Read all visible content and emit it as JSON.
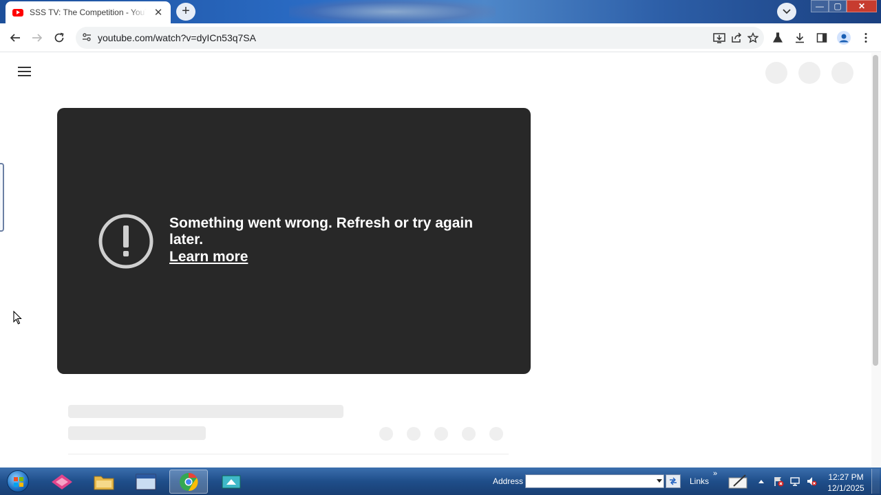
{
  "browser": {
    "tab": {
      "title": "SSS TV: The Competition - YouTube",
      "favicon": "youtube-icon",
      "close": "✕"
    },
    "new_tab": "+",
    "address_bar": {
      "url": "youtube.com/watch?v=dyICn53q7SA"
    },
    "window_controls": {
      "minimize": "—",
      "maximize": "▢",
      "close": "✕"
    }
  },
  "page": {
    "error": {
      "message": "Something went wrong. Refresh or try again later.",
      "link": "Learn more"
    }
  },
  "taskbar": {
    "address_label": "Address",
    "links_label": "Links",
    "links_chevron": "»",
    "clock": {
      "time": "12:27 PM",
      "date": "12/1/2025"
    }
  },
  "colors": {
    "player_background": "#282828",
    "youtube_red": "#ff0000",
    "skeleton": "#ececec"
  }
}
